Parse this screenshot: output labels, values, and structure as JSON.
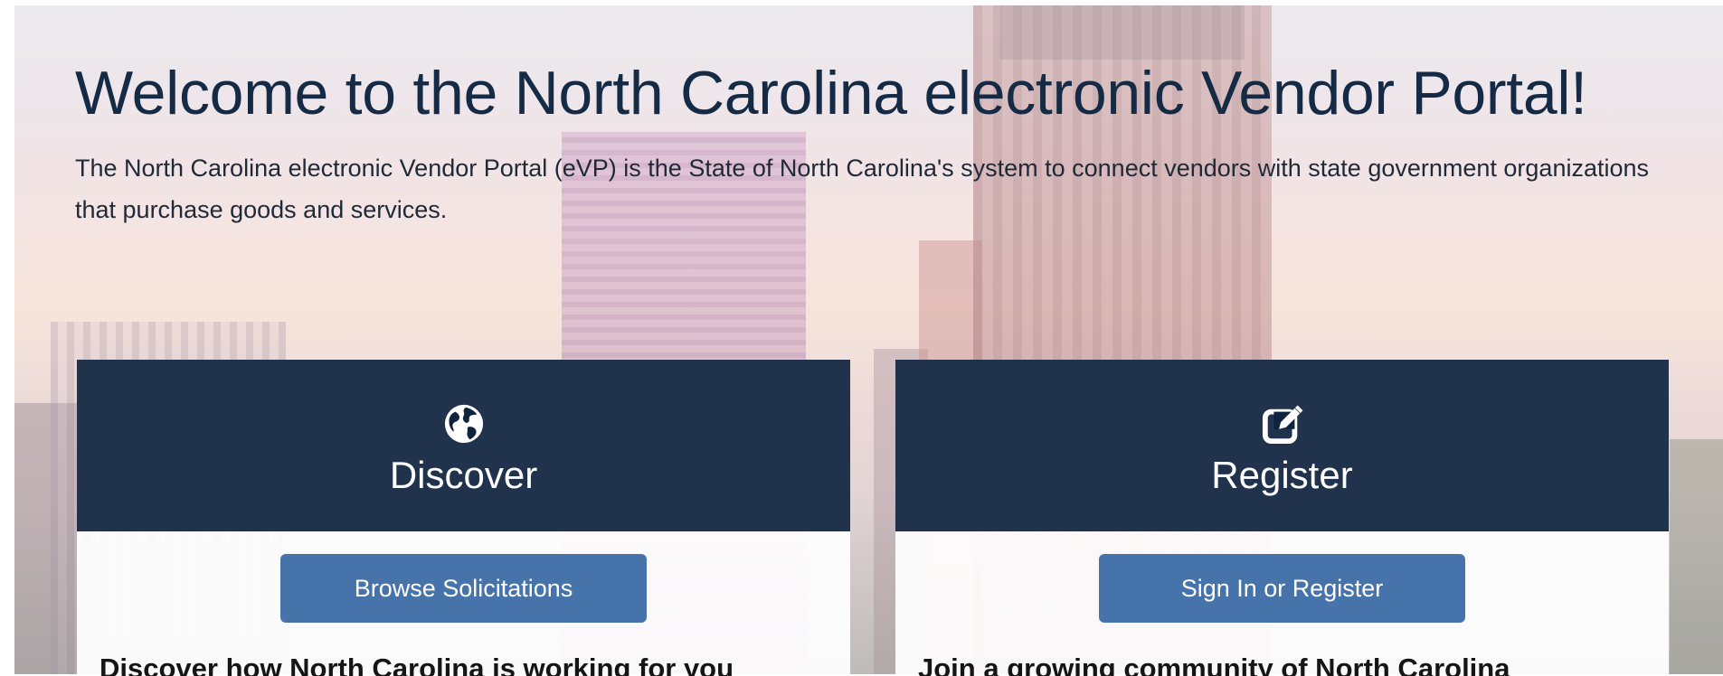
{
  "hero": {
    "title": "Welcome to the North Carolina electronic Vendor Portal!",
    "intro": "The North Carolina electronic Vendor Portal (eVP) is the State of North Carolina's system to connect vendors with state government organizations that purchase goods and services."
  },
  "cards": [
    {
      "icon": "globe-icon",
      "title": "Discover",
      "button": "Browse Solicitations",
      "subheading": "Discover how North Carolina is working for you"
    },
    {
      "icon": "edit-square-icon",
      "title": "Register",
      "button": "Sign In or Register",
      "subheading": "Join a growing community of North Carolina"
    }
  ],
  "colors": {
    "title_text": "#152a45",
    "card_header": "#10233e",
    "button": "#4673a9"
  }
}
